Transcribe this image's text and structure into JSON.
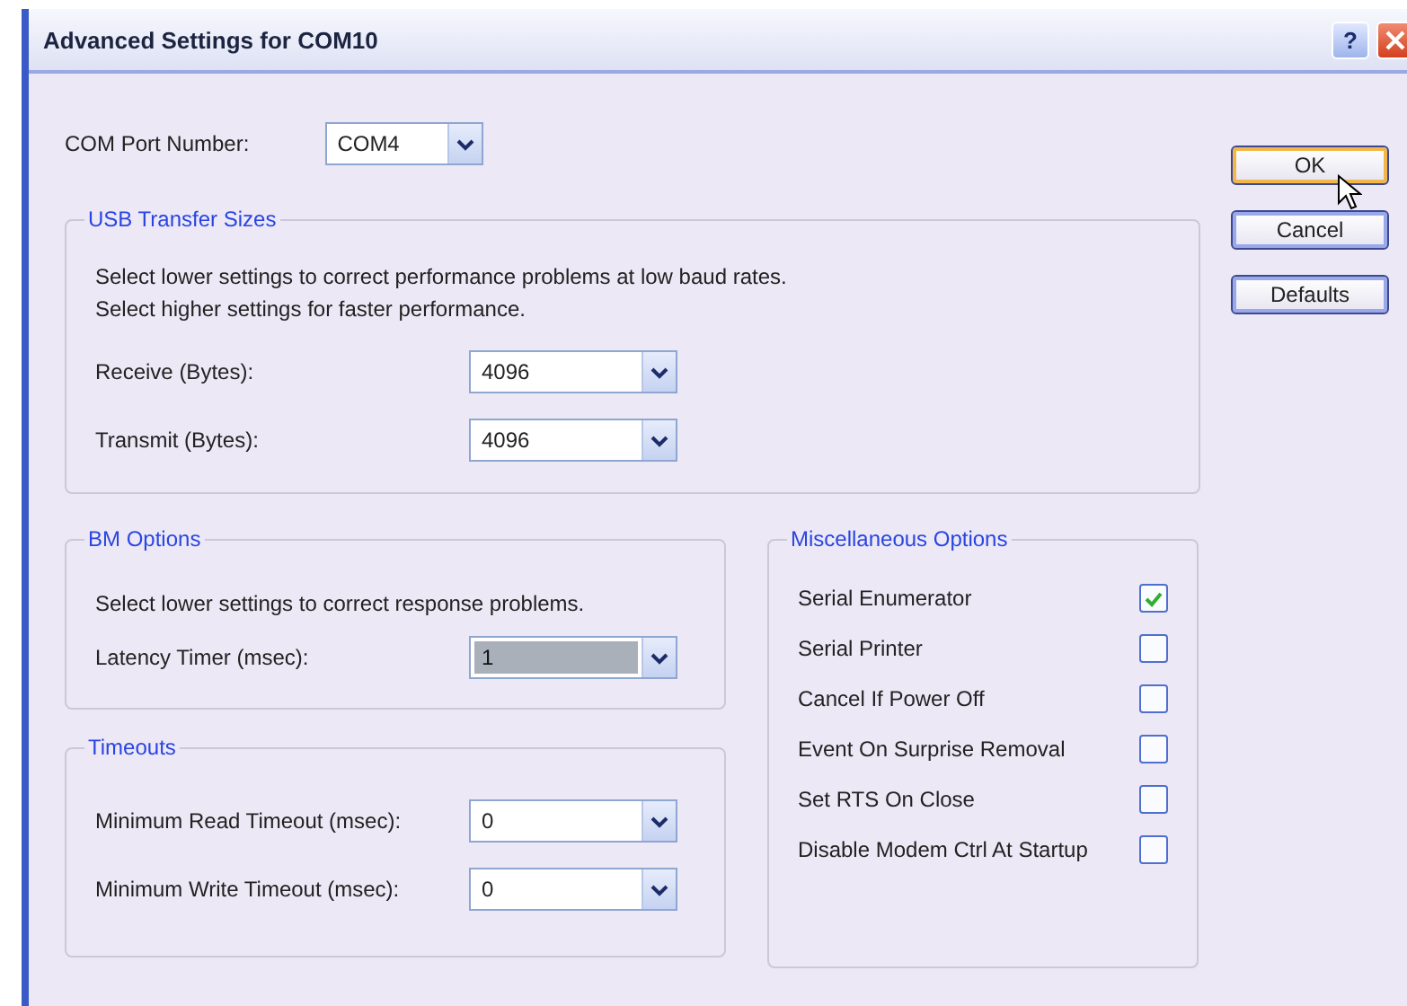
{
  "window": {
    "title": "Advanced Settings for COM10",
    "help_button": "?"
  },
  "com_port": {
    "label": "COM Port Number:",
    "value": "COM4",
    "focused": false
  },
  "usb_transfer_sizes": {
    "title": "USB Transfer Sizes",
    "description": [
      "Select lower settings to correct performance problems at low baud rates.",
      "Select higher settings for faster performance."
    ],
    "fields": [
      {
        "label": "Receive (Bytes):",
        "value": "4096",
        "focused": false
      },
      {
        "label": "Transmit (Bytes):",
        "value": "4096",
        "focused": false
      }
    ]
  },
  "bm_options": {
    "title": "BM Options",
    "description": [
      "Select lower settings to correct response problems."
    ],
    "fields": [
      {
        "label": "Latency Timer (msec):",
        "value": "1",
        "focused": true
      }
    ]
  },
  "timeouts": {
    "title": "Timeouts",
    "fields": [
      {
        "label": "Minimum Read Timeout (msec):",
        "value": "0",
        "focused": false
      },
      {
        "label": "Minimum Write Timeout (msec):",
        "value": "0",
        "focused": false
      }
    ]
  },
  "miscellaneous_options": {
    "title": "Miscellaneous Options",
    "items": [
      {
        "label": "Serial Enumerator",
        "checked": true
      },
      {
        "label": "Serial Printer",
        "checked": false
      },
      {
        "label": "Cancel If Power Off",
        "checked": false
      },
      {
        "label": "Event On Surprise Removal",
        "checked": false
      },
      {
        "label": "Set RTS On Close",
        "checked": false
      },
      {
        "label": "Disable Modem Ctrl At Startup",
        "checked": false
      }
    ]
  },
  "buttons": [
    {
      "label": "OK",
      "default": true
    },
    {
      "label": "Cancel",
      "default": false
    },
    {
      "label": "Defaults",
      "default": false
    }
  ]
}
